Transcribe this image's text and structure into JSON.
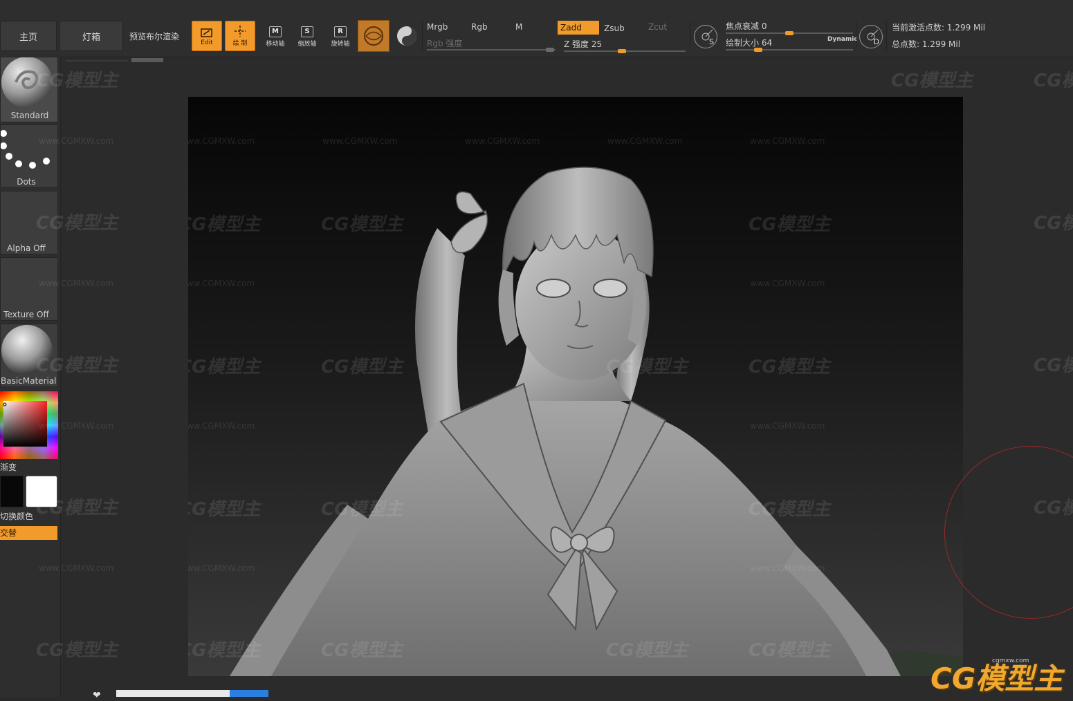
{
  "toolbar": {
    "home": "主页",
    "lightbox": "灯箱",
    "bpr_render": "预览布尔渲染",
    "edit": "Edit",
    "draw": "绘 制",
    "move_key": "M",
    "move": "移动轴",
    "scale_key": "S",
    "scale": "缩放轴",
    "rotate_key": "R",
    "rotate": "旋转轴",
    "mrgb": "Mrgb",
    "rgb": "Rgb",
    "m": "M",
    "zadd": "Zadd",
    "zsub": "Zsub",
    "zcut": "Zcut",
    "rgb_intensity": "Rgb 强度",
    "z_intensity": "Z 强度 25",
    "dial_s": "S",
    "focal_shift": "焦点衰减 0",
    "draw_size": "绘制大小 64",
    "dynamic": "Dynamic",
    "dial_d": "D",
    "active_points": "当前激活点数: 1.299 Mil",
    "total_points": "总点数: 1.299 Mil"
  },
  "sliders": {
    "rgb_intensity_fraction": 1.0,
    "z_intensity_fraction": 0.25,
    "focal_shift_fraction": 0.5,
    "draw_size_fraction": 0.25
  },
  "shelf": {
    "brush": "Standard",
    "stroke": "Dots",
    "alpha": "Alpha Off",
    "texture": "Texture Off",
    "material": "BasicMaterial",
    "gradient": "渐变",
    "switch_color": "切换颜色",
    "replace": "交替"
  },
  "watermark": {
    "logo": "CG模型主",
    "url": "www.CGMXW.com",
    "brand_url": "cgmxw.com"
  },
  "colors": {
    "accent": "#f29b2b",
    "background": "#2b2b2b",
    "canvas_top": "#060606",
    "main_color": "#080808",
    "secondary_color": "#ffffff"
  }
}
